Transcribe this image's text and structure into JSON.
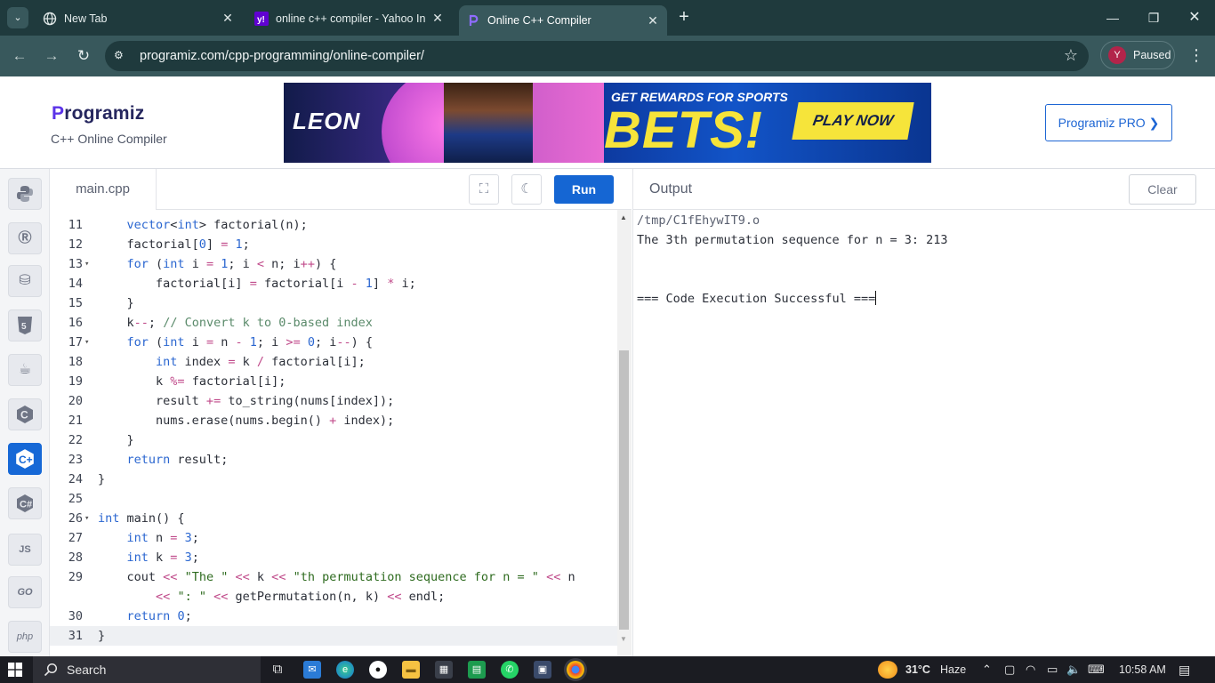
{
  "browser": {
    "tabs": [
      {
        "title": "New Tab",
        "icon": "globe-icon"
      },
      {
        "title": "online c++ compiler - Yahoo In",
        "icon": "yahoo-icon"
      },
      {
        "title": "Online C++ Compiler",
        "icon": "programiz-icon",
        "active": true
      }
    ],
    "url": "programiz.com/cpp-programming/online-compiler/",
    "profile": {
      "initial": "Y",
      "label": "Paused"
    }
  },
  "site": {
    "logo": "Programiz",
    "subtitle": "C++ Online Compiler",
    "pro_button": "Programiz PRO ❯",
    "ad": {
      "brand": "LEON",
      "tagline": "GET REWARDS FOR SPORTS",
      "headline": "BETS!",
      "cta": "PLAY NOW"
    }
  },
  "rail": {
    "languages": [
      "python-icon",
      "r-icon",
      "sql-icon",
      "html5-icon",
      "java-icon",
      "c-icon",
      "cpp-icon",
      "csharp-icon",
      "js-icon",
      "go-icon",
      "php-icon"
    ],
    "labels": {
      "js": "JS",
      "go": "GO",
      "php": "php"
    }
  },
  "editor": {
    "file_tab": "main.cpp",
    "run_label": "Run",
    "lines": [
      {
        "n": "11",
        "code": "    vector<int> factorial(n);"
      },
      {
        "n": "12",
        "code": "    factorial[0] = 1;"
      },
      {
        "n": "13",
        "code": "    for (int i = 1; i < n; i++) {",
        "fold": true
      },
      {
        "n": "14",
        "code": "        factorial[i] = factorial[i - 1] * i;"
      },
      {
        "n": "15",
        "code": "    }"
      },
      {
        "n": "16",
        "code": "    k--; // Convert k to 0-based index"
      },
      {
        "n": "17",
        "code": "    for (int i = n - 1; i >= 0; i--) {",
        "fold": true
      },
      {
        "n": "18",
        "code": "        int index = k / factorial[i];"
      },
      {
        "n": "19",
        "code": "        k %= factorial[i];"
      },
      {
        "n": "20",
        "code": "        result += to_string(nums[index]);"
      },
      {
        "n": "21",
        "code": "        nums.erase(nums.begin() + index);"
      },
      {
        "n": "22",
        "code": "    }"
      },
      {
        "n": "23",
        "code": "    return result;"
      },
      {
        "n": "24",
        "code": "}"
      },
      {
        "n": "25",
        "code": ""
      },
      {
        "n": "26",
        "code": "int main() {",
        "fold": true
      },
      {
        "n": "27",
        "code": "    int n = 3;"
      },
      {
        "n": "28",
        "code": "    int k = 3;"
      },
      {
        "n": "29",
        "code": "    cout << \"The \" << k << \"th permutation sequence for n = \" << n"
      },
      {
        "n": "",
        "code": "        << \": \" << getPermutation(n, k) << endl;"
      },
      {
        "n": "30",
        "code": "    return 0;"
      },
      {
        "n": "31",
        "code": "}",
        "active": true
      }
    ]
  },
  "output": {
    "title": "Output",
    "clear_label": "Clear",
    "path": "/tmp/C1fEhywIT9.o",
    "result": "The 3th permutation sequence for n = 3: 213",
    "status": "=== Code Execution Successful ==="
  },
  "taskbar": {
    "search": "Search",
    "temperature": "31°C",
    "weather": "Haze",
    "time": "10:58 AM"
  }
}
